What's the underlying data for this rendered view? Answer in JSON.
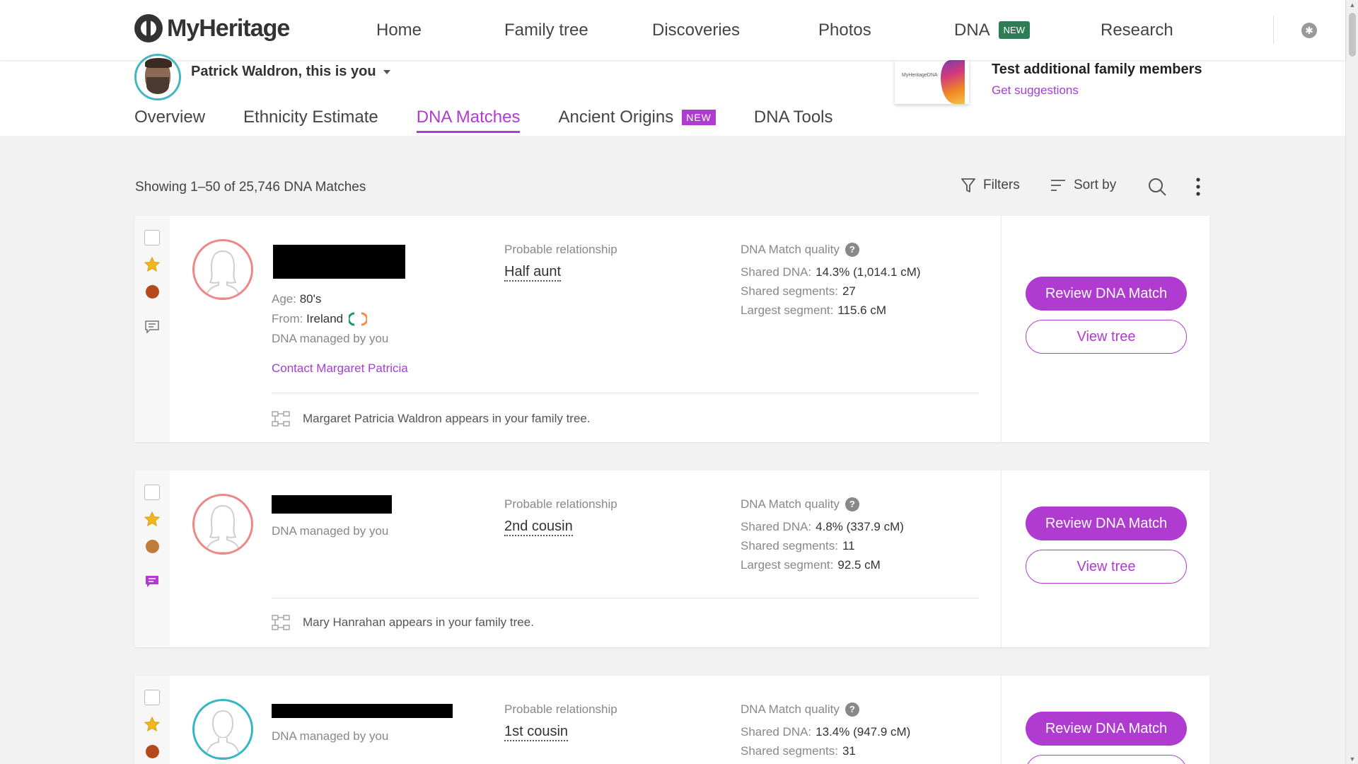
{
  "brand": {
    "name": "MyHeritage"
  },
  "nav": {
    "items": [
      "Home",
      "Family tree",
      "Discoveries",
      "Photos",
      "DNA",
      "Research"
    ],
    "dna_badge": "NEW"
  },
  "profile": {
    "name": "Patrick Waldron, this is you"
  },
  "promo": {
    "title": "Test additional family members",
    "link": "Get suggestions",
    "kit_text": "MyHeritageDNA"
  },
  "tabs": {
    "items": [
      "Overview",
      "Ethnicity Estimate",
      "DNA Matches",
      "Ancient Origins",
      "DNA Tools"
    ],
    "active": "DNA Matches",
    "ancient_badge": "NEW"
  },
  "list": {
    "showing": "Showing 1–50 of 25,746 DNA Matches",
    "filters": "Filters",
    "sort": "Sort by"
  },
  "labels": {
    "probable_relationship": "Probable relationship",
    "match_quality": "DNA Match quality",
    "shared_dna": "Shared DNA:",
    "shared_segments": "Shared segments:",
    "largest_segment": "Largest segment:",
    "age": "Age:",
    "from": "From:",
    "managed": "DNA managed by you",
    "review": "Review DNA Match",
    "view_tree": "View tree"
  },
  "matches": [
    {
      "age": "80's",
      "from": "Ireland",
      "contact": "Contact Margaret Patricia",
      "relationship": "Half aunt",
      "shared_dna": "14.3% (1,014.1 cM)",
      "shared_segments": "27",
      "largest_segment": "115.6 cM",
      "tree_note": "Margaret Patricia Waldron appears in your family tree.",
      "dot_color": "#b5491c",
      "has_message": false
    },
    {
      "relationship": "2nd cousin",
      "shared_dna": "4.8% (337.9 cM)",
      "shared_segments": "11",
      "largest_segment": "92.5 cM",
      "tree_note": "Mary Hanrahan appears in your family tree.",
      "dot_color": "#c07a3a",
      "has_message": true
    },
    {
      "relationship": "1st cousin",
      "shared_dna": "13.4% (947.9 cM)",
      "shared_segments": "31",
      "dot_color": "#b5491c"
    }
  ],
  "colors": {
    "accent": "#b03bd1",
    "teal": "#34b6c3",
    "badge_green": "#2e7d57"
  }
}
